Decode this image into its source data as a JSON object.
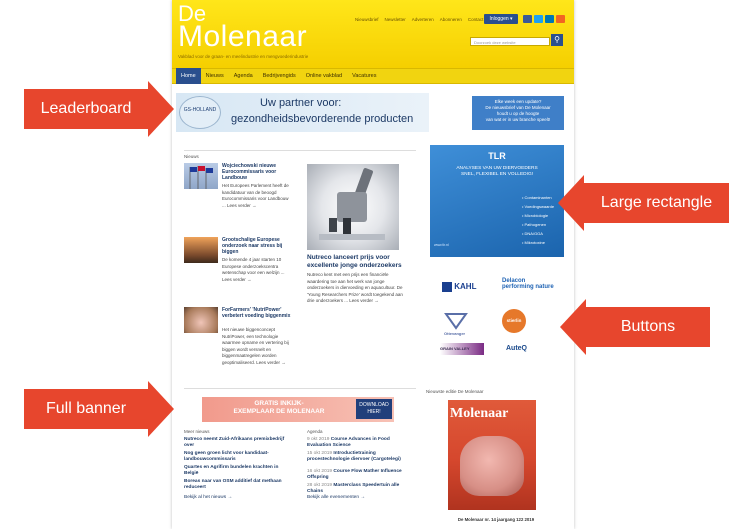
{
  "site": {
    "logo_de": "De",
    "logo_name": "Molenaar",
    "tagline": "Vakblad voor de graan- en meelindustrie en mengvoederindustrie",
    "top_links": [
      "Nieuwsbrief",
      "Newsletter",
      "Adverteren",
      "Abonneren",
      "Contact",
      "ENG"
    ],
    "login_label": "Inloggen ▾",
    "search_placeholder": "Doorzoek deze website",
    "nav": [
      "Home",
      "Nieuws",
      "Agenda",
      "Bedrijvengids",
      "Online vakblad",
      "Vacatures"
    ],
    "nav_active": "Home"
  },
  "leaderboard_ad": {
    "logo_text": "GS-HOLLAND",
    "line1": "Uw partner voor:",
    "line2": "gezondheidsbevorderende producten"
  },
  "side_promo": {
    "line1": "Elke week een update?",
    "line2": "De nieuwsbrief van De Molenaar",
    "line3": "houdt u op de hoogte",
    "line4": "van wat er in uw branche speelt!"
  },
  "news": {
    "header": "Nieuws",
    "items": [
      {
        "title": "Wojciechowski nieuwe Eurocommissaris voor Landbouw",
        "body": "Het Europees Parlement heeft de kandidatuur van de beoogd Eurocommissaris voor Landbouw ... Lees verder →"
      },
      {
        "title": "Grootschalige Europese onderzoek naar stress bij biggen",
        "body": "De komende 4 jaar starten 10 Europese onderzoekscentra wetenschap voor een welzijn ... Lees verder →"
      },
      {
        "title": "ForFarmers' 'NutriPower' verbetert voeding biggenmix",
        "body": "Het nieuwe biggenconcept NutriPower, een technologie waarmee opname en vertering bij biggen wordt versnelt en biggenmaatregelen worden geoptimaliseerd. Lees verder →"
      }
    ],
    "feature": {
      "title": "Nutreco lanceert prijs voor excellente jonge onderzoekers",
      "body": "Nutreco kent met een prijs een financiële waardering toe aan het werk van jonge onderzoekers in diervoeding en aquacultuur. De 'Young Researchers Prize' wordt toegekend aan drie onderzoekers ... Lees verder →"
    }
  },
  "banner_ad": {
    "text1": "GRATIS INKIJK-",
    "text2": "EXEMPLAAR DE MOLENAAR",
    "button": "DOWNLOAD HIER!"
  },
  "more_news": {
    "header": "Meer nieuws",
    "items": [
      "Nutreco neemt Zuid-Afrikaans premixbedrijf over",
      "Nog geen groen licht voor kandidaat-landbouwcommissaris",
      "Quartes en Agrifirm bundelen krachten in België",
      "Boreas naar van OSM additief dat methaan reduceert"
    ],
    "more_link": "Bekijk al het nieuws →"
  },
  "agenda": {
    "header": "Agenda",
    "items": [
      {
        "date": "9 okt 2019",
        "title": "Course Advances in Food Evaluation Science"
      },
      {
        "date": "15 okt 2019",
        "title": "Introductietraining procestechnologie diervoer (Cargotelegi)"
      },
      {
        "date": "16 okt 2019",
        "title": "Course Flow Mather Influence Offspring"
      },
      {
        "date": "28 okt 2019",
        "title": "Masterclass Speedertuin alle Chains"
      }
    ],
    "more_link": "Bekijk alle evenementen →"
  },
  "tlr_ad": {
    "logo": "TLR",
    "line1": "ANALYSES VAN UW DIERVOEDERS",
    "line2": "SNEL, FLEXIBEL EN VOLLEDIG!",
    "list": [
      "• Contaminanten",
      "• Voedingswaarde",
      "• Microbiologie",
      "• Pathogenen",
      "• DNA/GGA",
      "• Mikrotoxine"
    ],
    "footer": "www.tlr.nl"
  },
  "buttons": [
    {
      "name": "KAHL",
      "color": "#1a3f8f"
    },
    {
      "name": "Delacon performing nature",
      "color": "#1f63b4"
    },
    {
      "name": "Ottevanger",
      "color": "#5a6fa8"
    },
    {
      "name": "stierlin",
      "color": "#e6782a"
    },
    {
      "name": "GRAIN VALLEY",
      "color": "#7a2b84"
    },
    {
      "name": "AuteQ",
      "color": "#1b4a8c"
    }
  ],
  "newest_edition": {
    "header": "Nieuwste editie De Molenaar",
    "cover_title": "Molenaar",
    "caption": "De Molenaar nr. 14 jaargang 122 2019"
  },
  "callouts": {
    "leaderboard": "Leaderboard",
    "large_rectangle": "Large rectangle",
    "buttons": "Buttons",
    "full_banner": "Full banner",
    "color": "#e7462d"
  }
}
